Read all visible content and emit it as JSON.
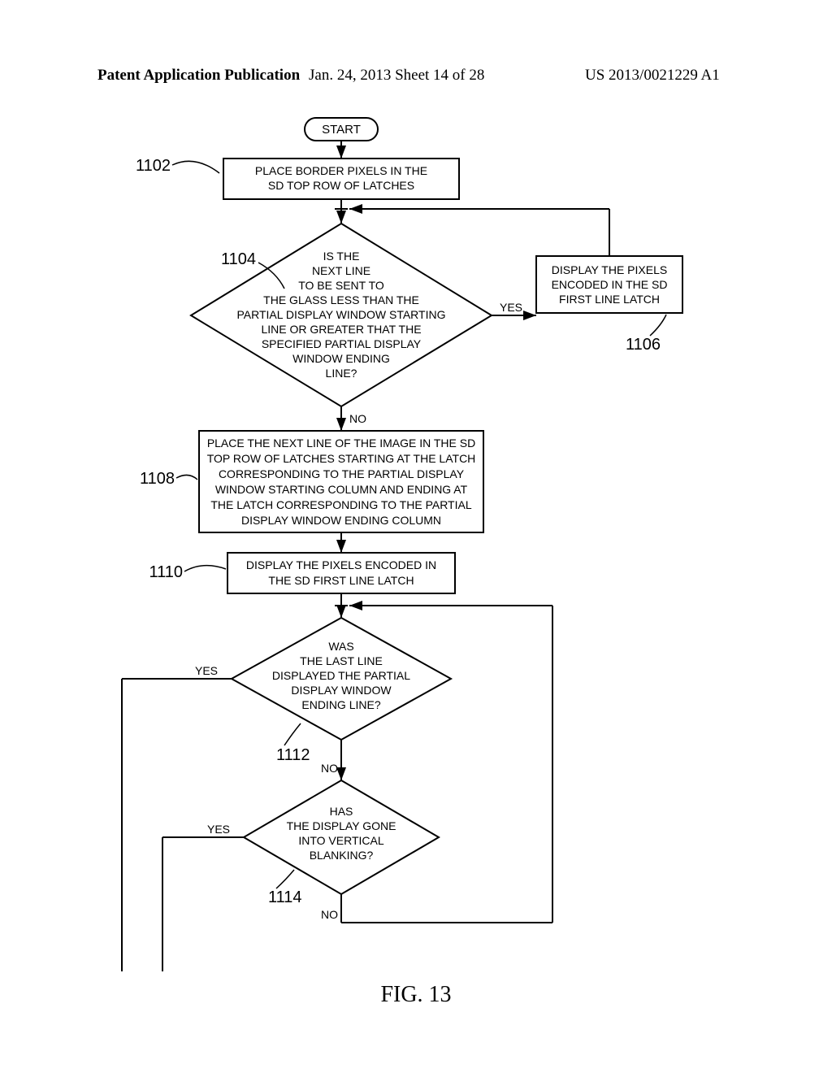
{
  "header": {
    "left": "Patent Application Publication",
    "mid": "Jan. 24, 2013  Sheet 14 of 28",
    "right": "US 2013/0021229 A1"
  },
  "figure_label": "FIG. 13",
  "refs": {
    "r1102": "1102",
    "r1104": "1104",
    "r1106": "1106",
    "r1108": "1108",
    "r1110": "1110",
    "r1112": "1112",
    "r1114": "1114"
  },
  "labels": {
    "yes": "YES",
    "no": "NO"
  },
  "nodes": {
    "start": "START",
    "b1102_l1": "PLACE BORDER PIXELS IN THE",
    "b1102_l2": "SD TOP ROW OF LATCHES",
    "d1104_l1": "IS THE",
    "d1104_l2": "NEXT LINE",
    "d1104_l3": "TO BE SENT TO",
    "d1104_l4": "THE GLASS LESS THAN THE",
    "d1104_l5": "PARTIAL DISPLAY WINDOW STARTING",
    "d1104_l6": "LINE OR GREATER THAT THE",
    "d1104_l7": "SPECIFIED PARTIAL DISPLAY",
    "d1104_l8": "WINDOW ENDING",
    "d1104_l9": "LINE?",
    "b1106_l1": "DISPLAY THE PIXELS",
    "b1106_l2": "ENCODED IN THE SD",
    "b1106_l3": "FIRST LINE LATCH",
    "b1108_l1": "PLACE THE NEXT LINE OF THE IMAGE IN THE SD",
    "b1108_l2": "TOP ROW OF LATCHES STARTING AT THE LATCH",
    "b1108_l3": "CORRESPONDING TO THE PARTIAL DISPLAY",
    "b1108_l4": "WINDOW STARTING COLUMN AND ENDING AT",
    "b1108_l5": "THE LATCH CORRESPONDING TO THE PARTIAL",
    "b1108_l6": "DISPLAY WINDOW ENDING COLUMN",
    "b1110_l1": "DISPLAY THE PIXELS ENCODED IN",
    "b1110_l2": "THE SD FIRST LINE LATCH",
    "d1112_l1": "WAS",
    "d1112_l2": "THE LAST LINE",
    "d1112_l3": "DISPLAYED THE PARTIAL",
    "d1112_l4": "DISPLAY WINDOW",
    "d1112_l5": "ENDING LINE?",
    "d1114_l1": "HAS",
    "d1114_l2": "THE DISPLAY GONE",
    "d1114_l3": "INTO VERTICAL",
    "d1114_l4": "BLANKING?"
  }
}
